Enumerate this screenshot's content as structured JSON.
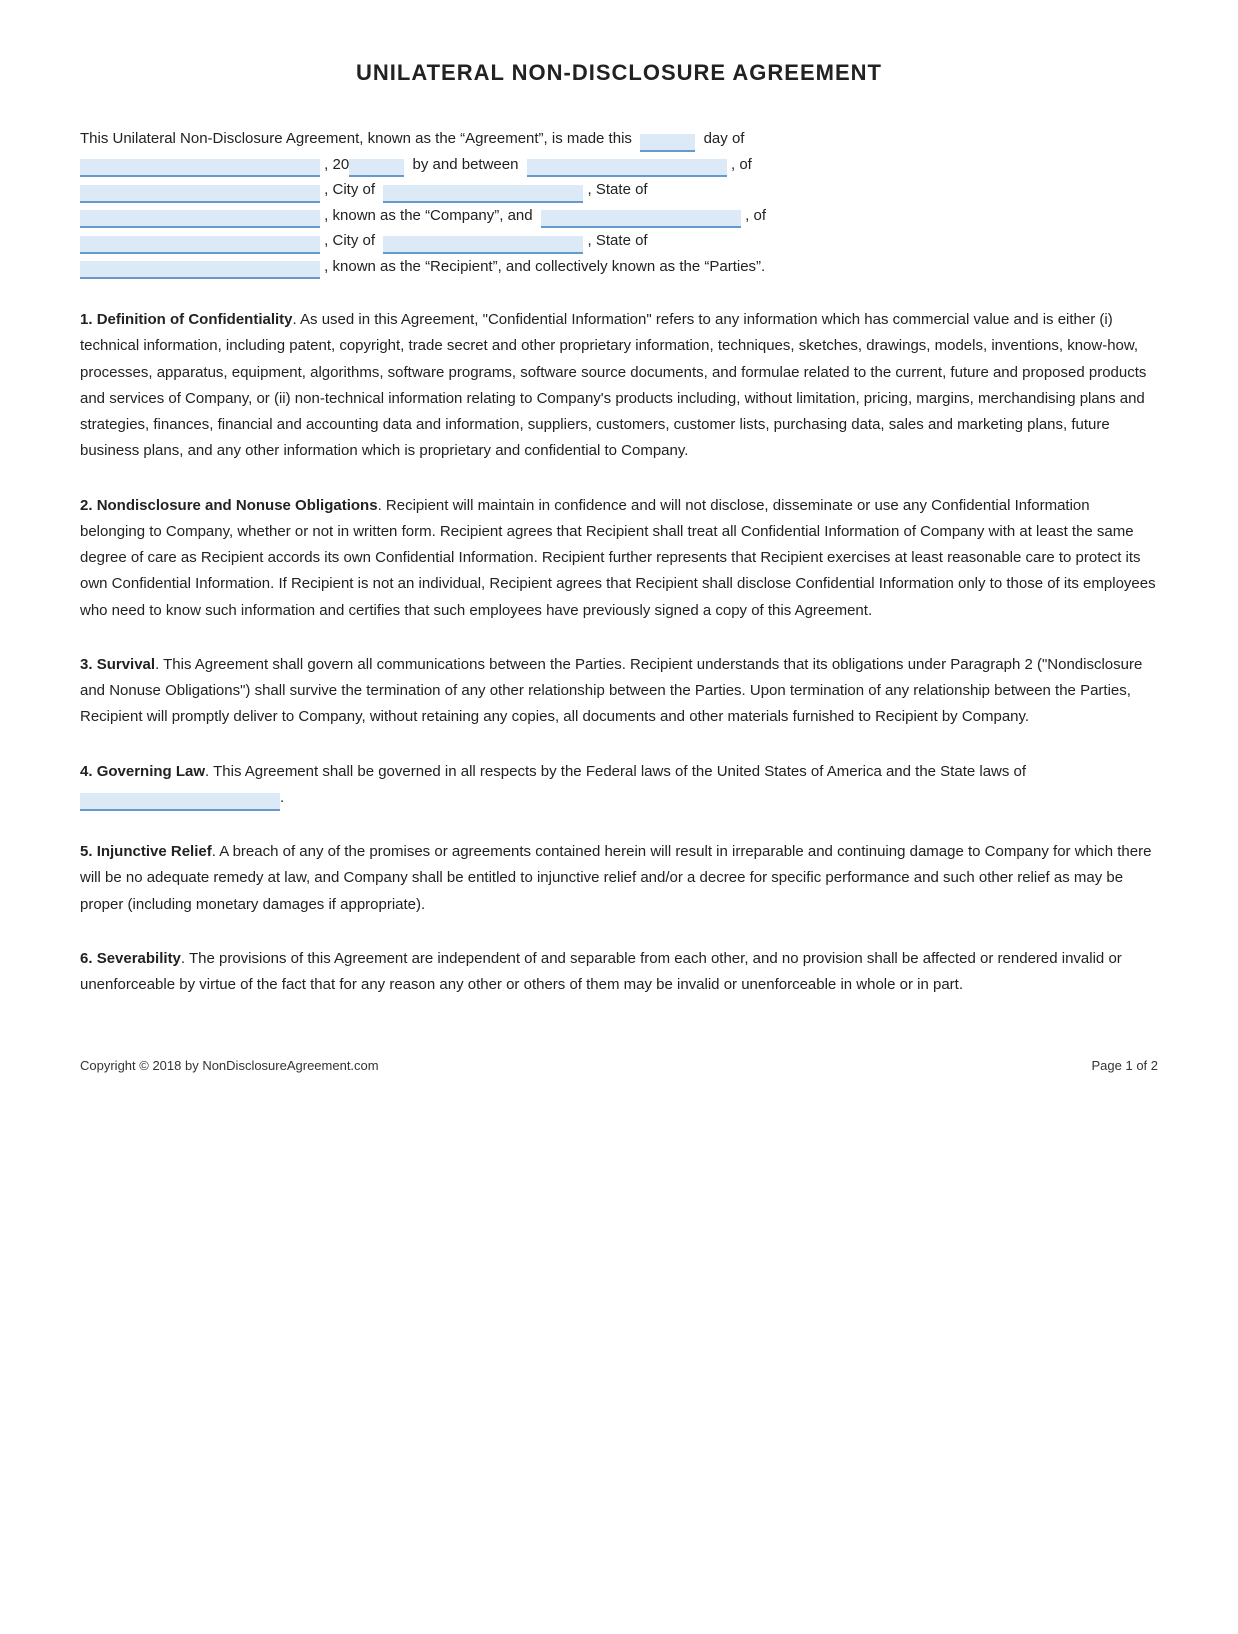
{
  "title": "UNILATERAL NON-DISCLOSURE AGREEMENT",
  "intro": {
    "line1_pre": "This Unilateral Non-Disclosure Agreement, known as the “Agreement”, is made this",
    "line1_post": "day of",
    "line2_pre": ", 20",
    "line2_mid": "by and between",
    "line2_post": ", of",
    "line3_pre": ", City of",
    "line3_mid": ", State of",
    "line4_pre": ", known as the “Company”, and",
    "line4_post": ", of",
    "line5_pre": ", City of",
    "line5_mid": ", State of",
    "line6_pre": ", known as the “Recipient”, and collectively known as the “Parties”."
  },
  "sections": [
    {
      "number": "1.",
      "title": "Definition of Confidentiality",
      "text": ". As used in this Agreement, \"Confidential Information\" refers to any information which has commercial value and is either (i) technical information, including patent, copyright, trade secret and other proprietary information, techniques, sketches, drawings, models, inventions, know-how, processes, apparatus, equipment, algorithms, software programs, software source documents, and formulae related to the current, future and proposed products and services of Company, or (ii) non-technical information relating to Company's products including, without limitation, pricing, margins, merchandising plans and strategies, finances, financial and accounting data and information, suppliers, customers, customer lists, purchasing data, sales and marketing plans, future business plans, and any other information which is proprietary and confidential to Company."
    },
    {
      "number": "2.",
      "title": "Nondisclosure and Nonuse Obligations",
      "text": ". Recipient will maintain in confidence and will not disclose, disseminate or use any Confidential Information belonging to Company, whether or not in written form. Recipient agrees that Recipient shall treat all Confidential Information of Company with at least the same degree of care as Recipient accords its own Confidential Information. Recipient further represents that Recipient exercises at least reasonable care to protect its own Confidential Information. If Recipient is not an individual, Recipient agrees that Recipient shall disclose Confidential Information only to those of its employees who need to know such information and certifies that such employees have previously signed a copy of this Agreement."
    },
    {
      "number": "3.",
      "title": "Survival",
      "text": ". This Agreement shall govern all communications between the Parties. Recipient understands that its obligations under Paragraph 2 (\"Nondisclosure and Nonuse Obligations\") shall survive the termination of any other relationship between the Parties. Upon termination of any relationship between the Parties, Recipient will promptly deliver to Company, without retaining any copies, all documents and other materials furnished to Recipient by Company."
    },
    {
      "number": "4.",
      "title": "Governing Law",
      "text": ".  This Agreement shall be governed in all respects by the Federal laws of the United States of America and the State laws of"
    },
    {
      "number": "5.",
      "title": "Injunctive Relief",
      "text": ".  A breach of any of the promises or agreements contained herein will result in irreparable and continuing damage to Company for which there will be no adequate remedy at law, and Company shall be entitled to injunctive relief and/or a decree for specific performance and such other relief as may be proper (including monetary damages if appropriate)."
    },
    {
      "number": "6.",
      "title": "Severability",
      "text": ". The provisions of this Agreement are independent of and separable from each other, and no provision shall be affected or rendered invalid or unenforceable by virtue of the fact that for any reason any other or others of them may be invalid or unenforceable in whole or in part."
    }
  ],
  "footer": {
    "copyright": "Copyright © 2018 by NonDisclosureAgreement.com",
    "page": "Page 1 of 2"
  }
}
